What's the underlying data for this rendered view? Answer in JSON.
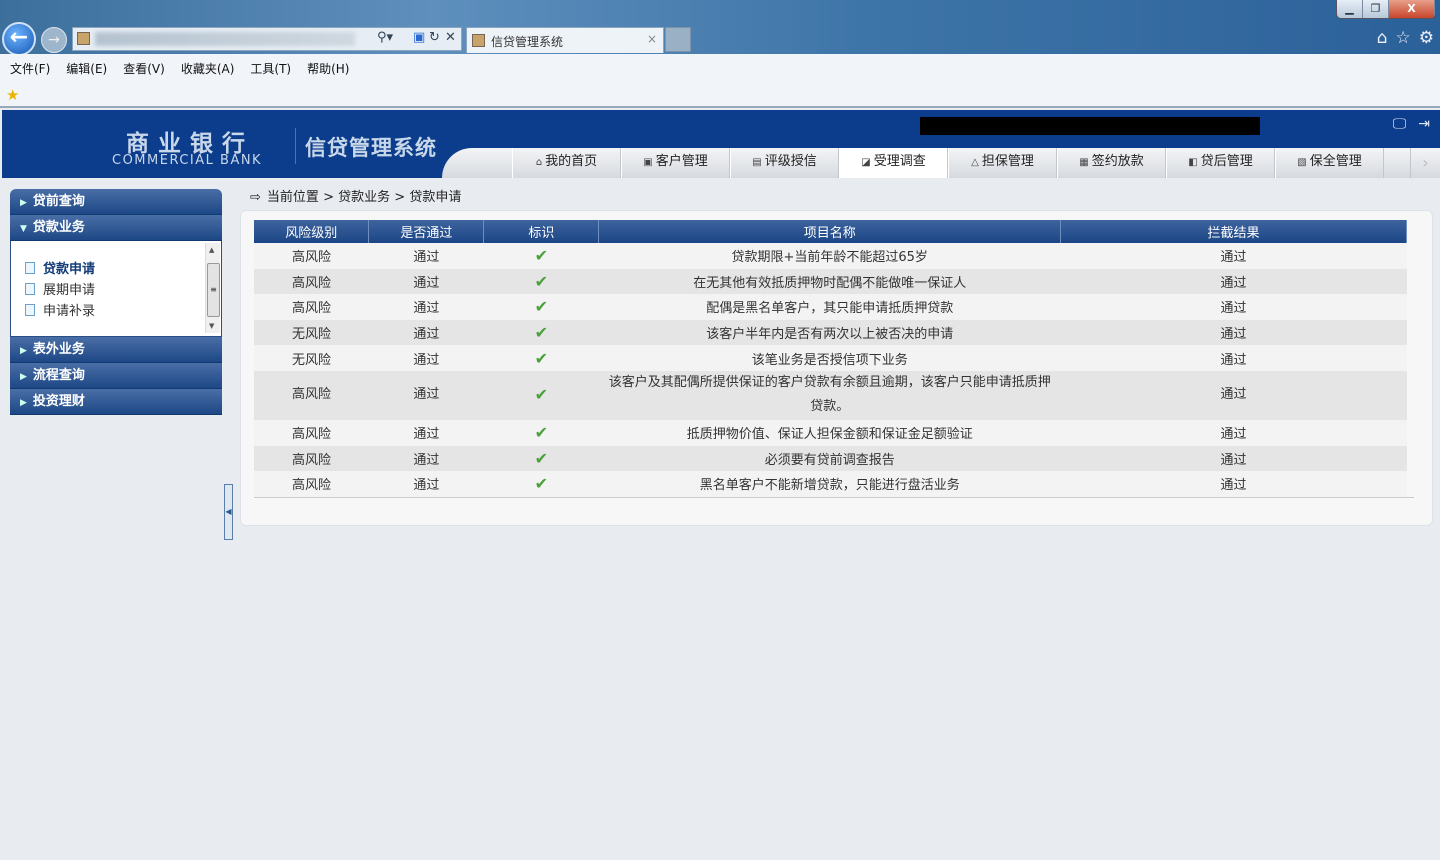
{
  "browser": {
    "tab_title": "信贷管理系统",
    "menu": [
      "文件(F)",
      "编辑(E)",
      "查看(V)",
      "收藏夹(A)",
      "工具(T)",
      "帮助(H)"
    ]
  },
  "header": {
    "bank_cn": "商业银行",
    "bank_en": "COMMERCIAL BANK",
    "system": "信贷管理系统",
    "tabs": [
      "我的首页",
      "客户管理",
      "评级授信",
      "受理调查",
      "担保管理",
      "签约放款",
      "贷后管理",
      "保全管理"
    ],
    "active_tab": "受理调查"
  },
  "sidebar": {
    "sections": [
      "贷前查询",
      "贷款业务",
      "表外业务",
      "流程查询",
      "投资理财"
    ],
    "sub_items": [
      "贷款申请",
      "展期申请",
      "申请补录"
    ]
  },
  "breadcrumb": {
    "label": "当前位置",
    "path": [
      "贷款业务",
      "贷款申请"
    ],
    "sep": ">"
  },
  "table": {
    "headers": [
      "风险级别",
      "是否通过",
      "标识",
      "项目名称",
      "拦截结果"
    ],
    "rows": [
      [
        "高风险",
        "通过",
        "✔",
        "贷款期限+当前年龄不能超过65岁",
        "通过"
      ],
      [
        "高风险",
        "通过",
        "✔",
        "在无其他有效抵质押物时配偶不能做唯一保证人",
        "通过"
      ],
      [
        "高风险",
        "通过",
        "✔",
        "配偶是黑名单客户，其只能申请抵质押贷款",
        "通过"
      ],
      [
        "无风险",
        "通过",
        "✔",
        "该客户半年内是否有两次以上被否决的申请",
        "通过"
      ],
      [
        "无风险",
        "通过",
        "✔",
        "该笔业务是否授信项下业务",
        "通过"
      ],
      [
        "高风险",
        "通过",
        "✔",
        "该客户及其配偶所提供保证的客户贷款有余额且逾期，该客户只能申请抵质押贷款。",
        "通过"
      ],
      [
        "高风险",
        "通过",
        "✔",
        "抵质押物价值、保证人担保金额和保证金足额验证",
        "通过"
      ],
      [
        "高风险",
        "通过",
        "✔",
        "必须要有贷前调查报告",
        "通过"
      ],
      [
        "高风险",
        "通过",
        "✔",
        "黑名单客户不能新增贷款，只能进行盘活业务",
        "通过"
      ]
    ]
  }
}
